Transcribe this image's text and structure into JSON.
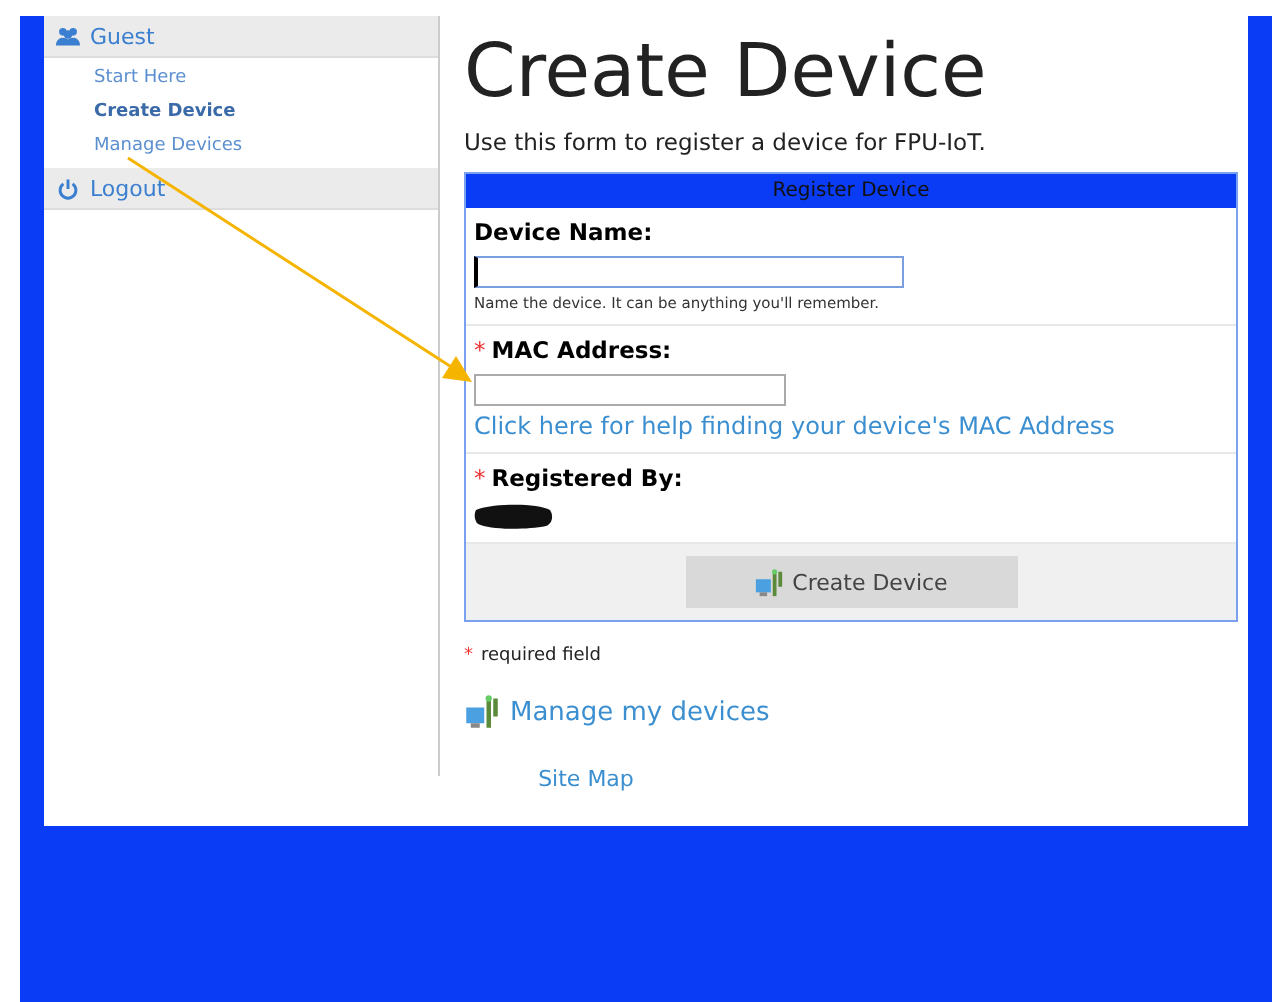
{
  "sidebar": {
    "sections": [
      {
        "title": "Guest",
        "kind": "group",
        "items": [
          {
            "label": "Start Here",
            "selected": false
          },
          {
            "label": "Create Device",
            "selected": true
          },
          {
            "label": "Manage Devices",
            "selected": false
          }
        ]
      },
      {
        "title": "Logout",
        "kind": "power"
      }
    ]
  },
  "page": {
    "title": "Create Device",
    "intro": "Use this form to register a device for FPU-IoT."
  },
  "form": {
    "header": "Register Device",
    "fields": [
      {
        "kind": "text",
        "label": "Device Name:",
        "required": false,
        "hint": "Name the device. It can be anything you'll remember.",
        "focused": true
      },
      {
        "kind": "text",
        "label": "MAC Address:",
        "required": true,
        "link": "Click here for help finding your device's MAC Address",
        "focused": false
      },
      {
        "kind": "redacted",
        "label": "Registered By:",
        "required": true
      }
    ],
    "submit": "Create Device"
  },
  "required_note": {
    "mark": "*",
    "text": "required field"
  },
  "manage_link": "Manage my devices",
  "footer_link": "Site Map"
}
